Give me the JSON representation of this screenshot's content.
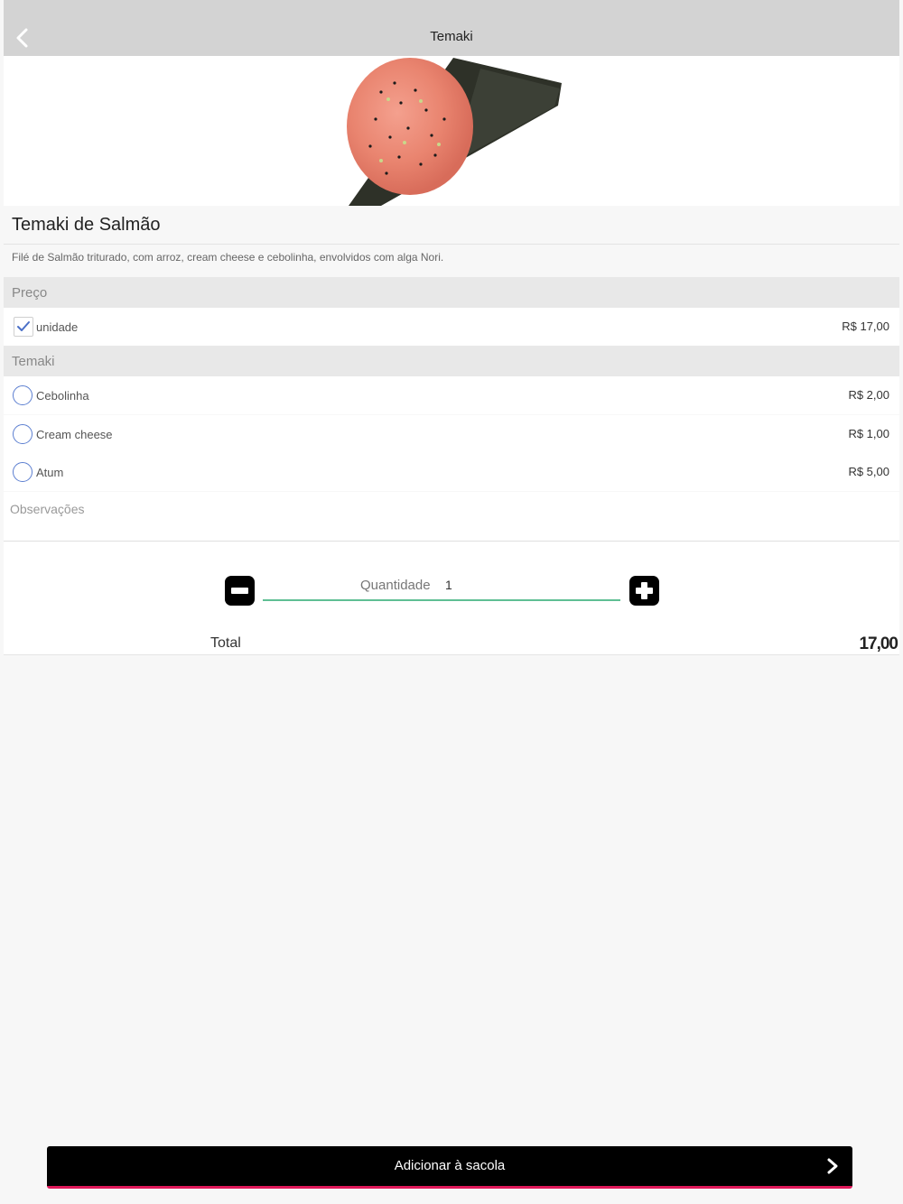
{
  "header": {
    "title": "Temaki",
    "back_icon": "chevron-left-icon"
  },
  "product": {
    "title": "Temaki de Salmão",
    "description": "Filé de Salmão triturado, com arroz, cream cheese e cebolinha, envolvidos com alga Nori."
  },
  "price_section": {
    "label": "Preço",
    "options": [
      {
        "label": "unidade",
        "price": "R$ 17,00",
        "checked": true
      }
    ]
  },
  "extras_section": {
    "label": "Temaki",
    "options": [
      {
        "label": "Cebolinha",
        "price": "R$ 2,00",
        "selected": false
      },
      {
        "label": "Cream cheese",
        "price": "R$ 1,00",
        "selected": false
      },
      {
        "label": "Atum",
        "price": "R$ 5,00",
        "selected": false
      }
    ]
  },
  "notes": {
    "placeholder": "Observações"
  },
  "quantity": {
    "label": "Quantidade",
    "value": "1"
  },
  "total": {
    "label": "Total",
    "value": "17,00"
  },
  "cta": {
    "label": "Adicionar à sacola"
  },
  "colors": {
    "header_bg": "#d3d3d3",
    "accent_green": "#5fbf94",
    "accent_pink": "#e0185a",
    "radio_blue": "#5b7ed0"
  }
}
